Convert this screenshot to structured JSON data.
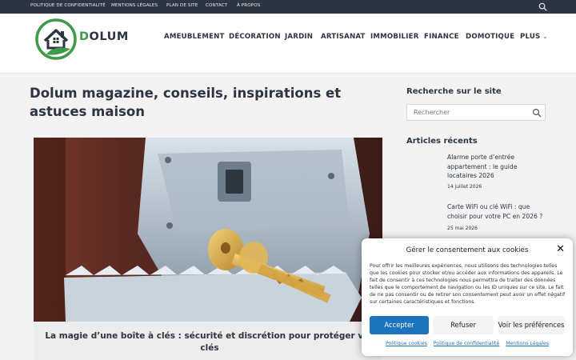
{
  "topbar": {
    "links": [
      "POLITIQUE DE CONFIDENTIALITÉ",
      "MENTIONS LÉGALES",
      "PLAN DE SITE",
      "CONTACT",
      "À PROPOS"
    ]
  },
  "header": {
    "logo_letter": "D",
    "logo_rest": "OLUM",
    "nav": [
      "AMEUBLEMENT",
      "DÉCORATION",
      "JARDIN",
      "ARTISANAT",
      "IMMOBILIER",
      "FINANCE",
      "DOMOTIQUE",
      "PLUS"
    ]
  },
  "main": {
    "title": "Dolum magazine, conseils, inspirations et astuces maison",
    "featured_caption": "La magie d’une boîte à clés : sécurité et discrétion pour protéger vos clés"
  },
  "sidebar": {
    "search_heading": "Recherche sur le site",
    "search_placeholder": "Rechercher",
    "recent_heading": "Articles récents",
    "posts": [
      {
        "title": "Alarme porte d’entrée appartement : le guide locataires 2026",
        "date": "14 juillet 2026"
      },
      {
        "title": "Carte WiFi ou clé WiFi : que choisir pour votre PC en 2026 ?",
        "date": "25 mai 2026"
      }
    ]
  },
  "cookie": {
    "title": "Gérer le consentement aux cookies",
    "text": "Pour offrir les meilleures expériences, nous utilisons des technologies telles que les cookies pour stocker et/ou accéder aux informations des appareils. Le fait de consentir à ces technologies nous permettra de traiter des données telles que le comportement de navigation ou les ID uniques sur ce site. Le fait de ne pas consentir ou de retirer son consentement peut avoir un effet négatif sur certaines caractéristiques et fonctions.",
    "accept": "Accepter",
    "refuse": "Refuser",
    "prefs": "Voir les préférences",
    "links": [
      "Politique cookies",
      "Politique de confidentialité",
      "Mentions Légales"
    ],
    "accent": "#1e73be"
  },
  "icons": [
    "search-icon",
    "logo-house-icon",
    "chevron-down-icon",
    "close-icon"
  ],
  "colors": {
    "topbar": "#2c3541",
    "brand_green": "#3f9a49",
    "text": "#2c3541"
  }
}
